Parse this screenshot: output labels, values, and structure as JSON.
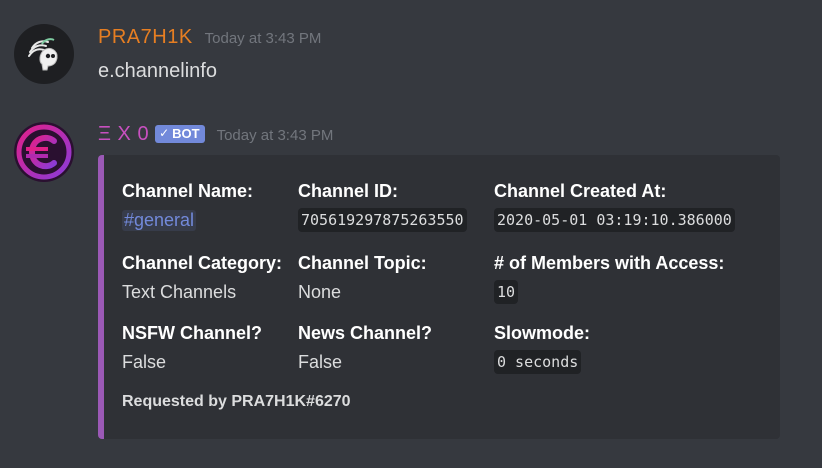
{
  "messages": [
    {
      "username": "PRA7H1K",
      "username_color": "#e67e22",
      "timestamp": "Today at 3:43 PM",
      "content": "e.channelinfo",
      "avatar_icon": "winged-skull-icon"
    },
    {
      "username": "Ξ X 0",
      "username_color": "#c850c0",
      "bot_badge": "BOT",
      "bot_check": "✓",
      "timestamp": "Today at 3:43 PM",
      "avatar_icon": "euro-sign-icon"
    }
  ],
  "embed": {
    "accent_color": "#9b59b6",
    "fields": [
      {
        "name": "Channel Name:",
        "value": "#general"
      },
      {
        "name": "Channel ID:",
        "value": "705619297875263550"
      },
      {
        "name": "Channel Created At:",
        "value": "2020-05-01 03:19:10.386000"
      },
      {
        "name": "Channel Category:",
        "value": "Text Channels"
      },
      {
        "name": "Channel Topic:",
        "value": "None"
      },
      {
        "name": "# of Members with Access:",
        "value": "10"
      },
      {
        "name": "NSFW Channel?",
        "value": "False"
      },
      {
        "name": "News Channel?",
        "value": "False"
      },
      {
        "name": "Slowmode:",
        "value": "0 seconds"
      }
    ],
    "footer": "Requested by PRA7H1K#6270"
  }
}
